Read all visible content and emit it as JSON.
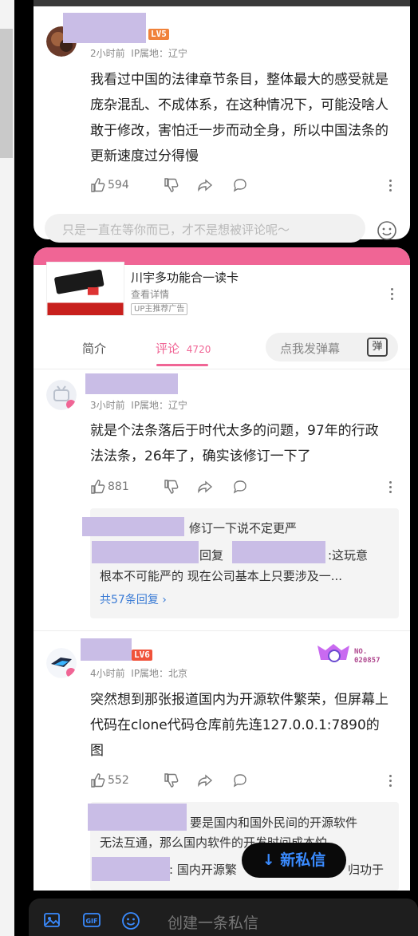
{
  "comment1": {
    "time": "2小时前",
    "ip": "IP属地：辽宁",
    "level": "LV5",
    "text": "我看过中国的法律章节条目，整体最大的感受就是庞杂混乱、不成体系，在这种情况下，可能没啥人敢于修改，害怕迁一步而动全身，所以中国法条的更新速度过分得慢",
    "likes": "594"
  },
  "reply_input": {
    "placeholder": "只是一直在等你而已，才不是想被评论呢～"
  },
  "ad": {
    "title": "川宇多功能合一读卡",
    "subtitle": "查看详情",
    "tag": "UP主推荐广告"
  },
  "tabs": {
    "intro": "简介",
    "comments": "评论",
    "comment_count": "4720",
    "danmu_placeholder": "点我发弹幕",
    "danmu_icon": "弹"
  },
  "comment2": {
    "time": "3小时前",
    "ip": "IP属地：辽宁",
    "text": "就是个法条落后于时代太多的问题，97年的行政法法条，26年了，确实该修订一下了",
    "likes": "881",
    "replies": {
      "r1": "修订一下说不定更严",
      "r2a": "回复",
      "r2b": ":这玩意",
      "r2c": "根本不可能严的 现在公司基本上只要涉及一...",
      "more": "共57条回复 ›"
    }
  },
  "comment3": {
    "time": "4小时前",
    "ip": "IP属地：北京",
    "level": "LV6",
    "badge_no": "NO.\n020857",
    "text": "突然想到那张报道国内为开源软件繁荣，但屏幕上代码在clone代码仓库前先连127.0.0.1:7890的图",
    "likes": "552",
    "replies": {
      "r1a": "要是国内和国外民间的开源软件",
      "r1b": "无法互通，那么国内软件的开发时间成本怕...",
      "r2a": ": 国内开源繁",
      "r2b": "归功于"
    }
  },
  "new_message_button": "↓ 新私信",
  "composer": {
    "placeholder": "创建一条私信"
  }
}
